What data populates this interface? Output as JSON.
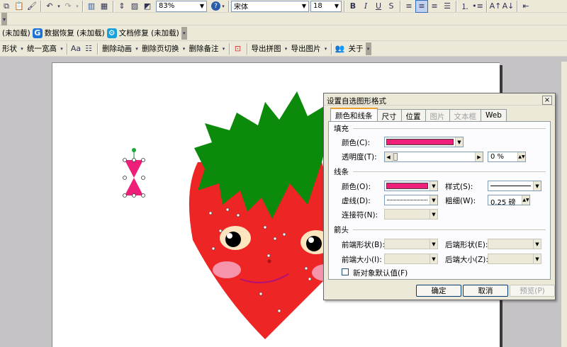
{
  "toolbar1": {
    "zoom": "83%",
    "font_name": "宋体",
    "font_size": "18"
  },
  "toolbar2": {
    "addin1": "(未加载)",
    "addin2": "数据恢复 (未加载)",
    "addin3": "文档修复 (未加载)"
  },
  "toolbar3": {
    "items": [
      "形状",
      "统一宽高",
      "删除动画",
      "删除页切换",
      "删除备注",
      "导出拼图",
      "导出图片",
      "关于"
    ]
  },
  "dialog": {
    "title": "设置自选图形格式",
    "close": "×",
    "tabs": [
      "颜色和线条",
      "尺寸",
      "位置",
      "图片",
      "文本框",
      "Web"
    ],
    "fill_section": "填充",
    "fill_color_label": "颜色(C):",
    "transparency_label": "透明度(T):",
    "transparency_value": "0 %",
    "line_section": "线条",
    "line_color_label": "颜色(O):",
    "style_label": "样式(S):",
    "dashed_label": "虚线(D):",
    "weight_label": "粗细(W):",
    "weight_value": "0.25 磅",
    "connector_label": "连接符(N):",
    "arrows_section": "箭头",
    "begin_style_label": "前端形状(B):",
    "end_style_label": "后端形状(E):",
    "begin_size_label": "前端大小(I):",
    "end_size_label": "后端大小(Z):",
    "default_checkbox_label": "新对象默认值(F)",
    "ok": "确定",
    "cancel": "取消",
    "preview": "预览(P)",
    "fill_color": "#ee1f78",
    "line_color": "#ee1f78"
  }
}
